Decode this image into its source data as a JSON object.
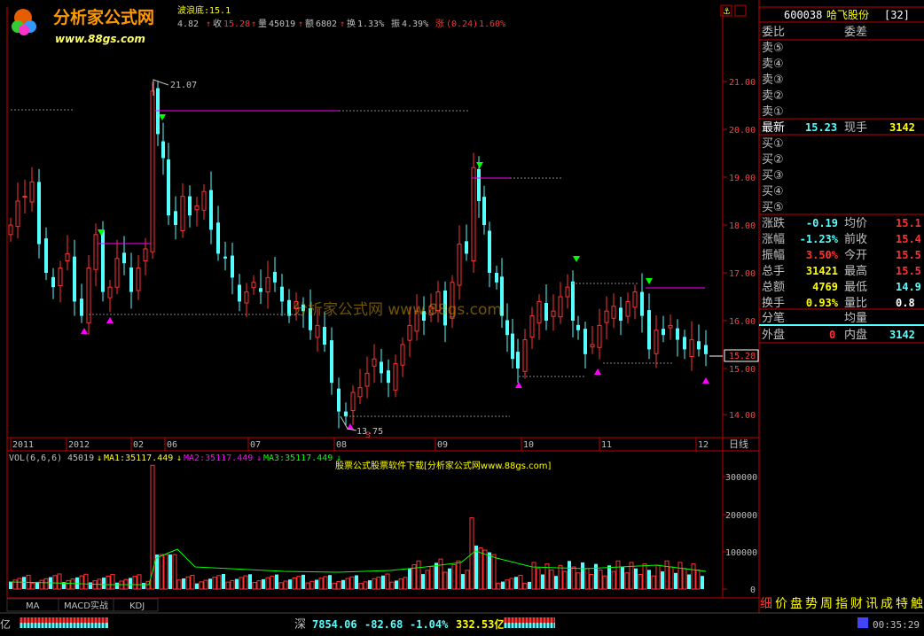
{
  "logo": {
    "text": "分析家公式网",
    "url": "www.88gs.com"
  },
  "header_stats": {
    "wave": "波浪底:15.1",
    "open": "4.82",
    "close_label": "收",
    "close": "15.28",
    "vol_label": "量",
    "vol": "45019",
    "amt_label": "额",
    "amt": "6802",
    "turn_label": "换",
    "turn": "1.33%",
    "amp_label": "振",
    "amp": "4.39%",
    "chg_label": "涨",
    "chg": "(0.24)",
    "chg_pct": "1.60%"
  },
  "chart_labels": {
    "peak_price": "21.07",
    "low_price": "13.75",
    "current_price": "15.28",
    "watermark": "分析家公式网 www.88gs.com"
  },
  "price_axis": [
    "21.00",
    "20.00",
    "19.00",
    "18.00",
    "17.00",
    "16.00",
    "15.00",
    "14.00"
  ],
  "time_axis": [
    "2011",
    "2012",
    "02",
    "06",
    "07",
    "08",
    "09",
    "10",
    "11",
    "12"
  ],
  "period_label": "日线",
  "vol_header": {
    "name": "VOL(6,6,6)",
    "vol": "45019",
    "ma1": "MA1:35117.449",
    "ma2": "MA2:35117.449",
    "ma3": "MA3:35117.449",
    "promo": "股票公式股票软件下载[分析家公式网www.88gs.com]"
  },
  "vol_axis": [
    "300000",
    "200000",
    "100000",
    "0"
  ],
  "indicator_tabs": [
    "MA",
    "MACD实战",
    "KDJ"
  ],
  "quote_panel": {
    "code": "600038",
    "name": "哈飞股份",
    "suffix": "[32]",
    "webi_label": "委比",
    "weicha_label": "委差",
    "sell_labels": [
      "卖⑤",
      "卖④",
      "卖③",
      "卖②",
      "卖①"
    ],
    "latest_label": "最新",
    "latest": "15.23",
    "xianshou_label": "现手",
    "xianshou": "3142",
    "buy_labels": [
      "买①",
      "买②",
      "买③",
      "买④",
      "买⑤"
    ],
    "rows": [
      {
        "l": "涨跌",
        "v": "-0.19",
        "r": "均价",
        "rv": "15.1"
      },
      {
        "l": "涨幅",
        "v": "-1.23%",
        "r": "前收",
        "rv": "15.4"
      },
      {
        "l": "振幅",
        "v": "3.50%",
        "r": "今开",
        "rv": "15.5"
      },
      {
        "l": "总手",
        "v": "31421",
        "r": "最高",
        "rv": "15.5"
      },
      {
        "l": "总额",
        "v": "4769",
        "r": "最低",
        "rv": "14.9"
      },
      {
        "l": "换手",
        "v": "0.93%",
        "r": "量比",
        "rv": "0.8"
      }
    ],
    "fenbi_label": "分笔",
    "junliang_label": "均量",
    "waipan_label": "外盘",
    "waipan": "0",
    "neipan_label": "内盘",
    "neipan": "3142",
    "tabs": [
      "细",
      "价",
      "盘",
      "势",
      "周",
      "指",
      "财",
      "讯",
      "成",
      "特",
      "触"
    ]
  },
  "status_bar": {
    "left_label": "亿",
    "index_name": "深",
    "index_value": "7854.06",
    "index_change": "-82.68",
    "index_pct": "-1.04%",
    "index_amount": "332.53亿",
    "clock": "00:35:29"
  },
  "colors": {
    "up": "#ff3232",
    "down": "#54ffff",
    "axis": "#c00000",
    "purple": "#ff00ff",
    "green": "#00ff00",
    "yellow": "#ffff00"
  }
}
